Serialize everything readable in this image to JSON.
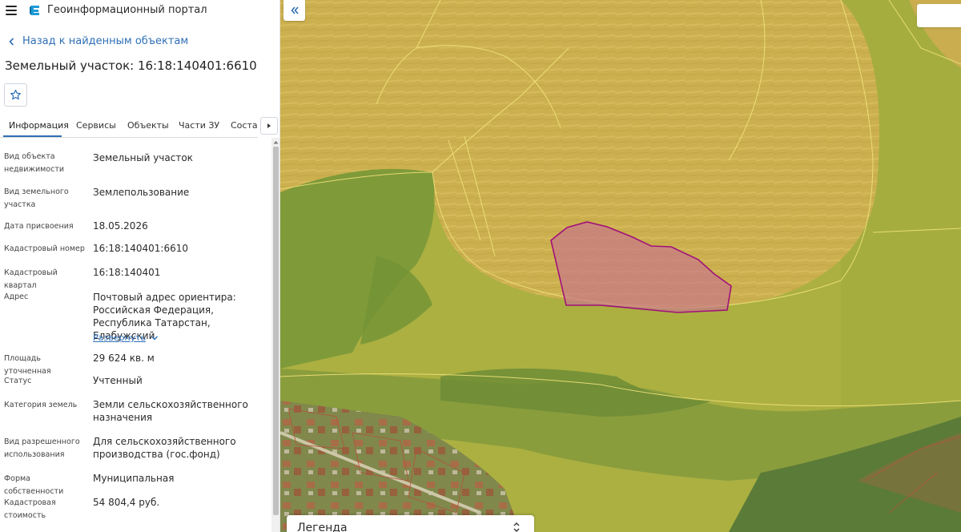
{
  "app": {
    "title": "Геоинформационный портал"
  },
  "navigation": {
    "back_label": "Назад к найденным объектам"
  },
  "object": {
    "title": "Земельный участок: 16:18:140401:6610"
  },
  "tabs": [
    {
      "label": "Информация",
      "active": true
    },
    {
      "label": "Сервисы",
      "active": false
    },
    {
      "label": "Объекты",
      "active": false
    },
    {
      "label": "Части ЗУ",
      "active": false
    },
    {
      "label": "Состав",
      "active": false
    }
  ],
  "info": {
    "rows": [
      {
        "label": "Вид объекта недвижимости",
        "value": "Земельный участок"
      },
      {
        "label": "Вид земельного участка",
        "value": "Землепользование"
      },
      {
        "label": "Дата присвоения",
        "value": "18.05.2026"
      },
      {
        "label": "Кадастровый номер",
        "value": "16:18:140401:6610"
      },
      {
        "label": "Кадастровый квартал",
        "value": "16:18:140401"
      },
      {
        "label": "Адрес",
        "value": "Почтовый адрес ориентира: Российская Федерация, Республика Татарстан, Елабужский"
      },
      {
        "label": "Площадь уточненная",
        "value": "29 624 кв. м"
      },
      {
        "label": "Статус",
        "value": "Учтенный"
      },
      {
        "label": "Категория земель",
        "value": "Земли сельскохозяйственного назначения"
      },
      {
        "label": "Вид разрешенного использования",
        "value": "Для сельскохозяйственного производства (гос.фонд)"
      },
      {
        "label": "Форма собственности",
        "value": "Муниципальная"
      },
      {
        "label": "Кадастровая стоимость",
        "value": "54 804,4 руб."
      }
    ],
    "expand_label": "Развернуть"
  },
  "map": {
    "legend_label": "Легенда",
    "selected_parcel_color": "#a0107a",
    "field_color": "#c9a94e",
    "meadow_color": "#9aa63a"
  },
  "icons": {
    "menu": "menu-icon",
    "logo": "logo-icon",
    "back": "chevron-left-icon",
    "favorite": "star-icon",
    "tabs_next": "triangle-right-icon",
    "expand": "chevron-down-icon",
    "collapse": "double-chevron-left-icon",
    "legend_toggle": "chevron-up-down-icon"
  }
}
